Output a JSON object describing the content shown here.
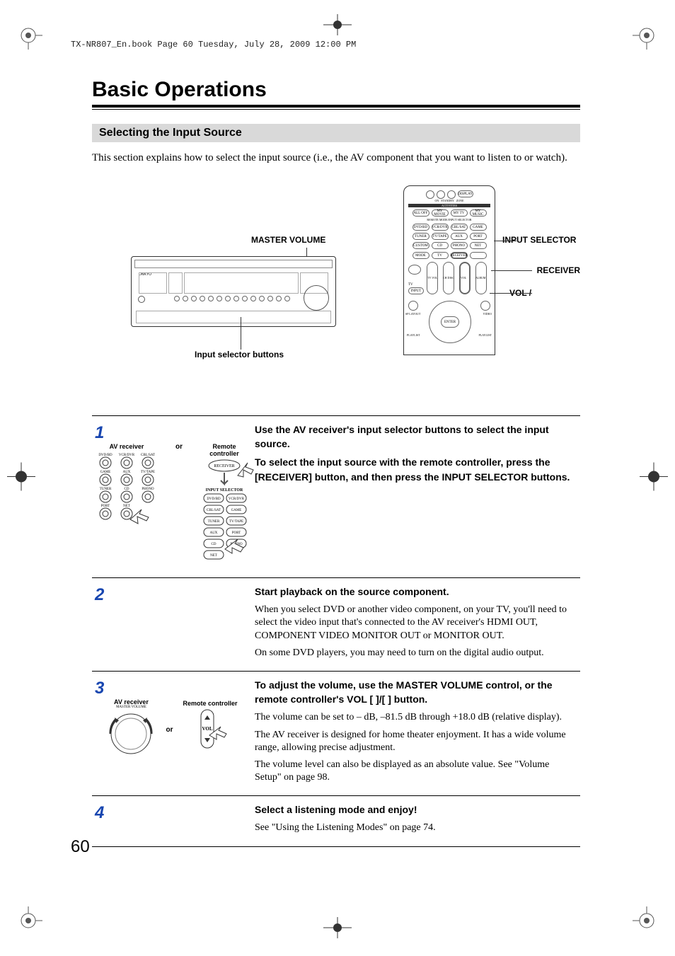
{
  "header_running": "TX-NR807_En.book  Page 60  Tuesday, July 28, 2009  12:00 PM",
  "main_heading": "Basic Operations",
  "section_heading": "Selecting the Input Source",
  "intro_text": "This section explains how to select the input source (i.e., the AV component that you want to listen to or watch).",
  "labels": {
    "master_volume": "MASTER VOLUME",
    "input_selector_buttons": "Input selector buttons",
    "input_selector": "INPUT SELECTOR",
    "receiver": "RECEIVER",
    "vol": "VOL    / ",
    "av_receiver": "AV receiver",
    "remote_controller": "Remote controller",
    "or": "or"
  },
  "remote_buttons": {
    "top": [
      "ON",
      "STANDBY",
      "ZONE",
      "DISPLAY"
    ],
    "activities_header": "ACTIVITIES",
    "activities": [
      "ALL OFF",
      "MY MOVIE",
      "MY TV",
      "MY MUSIC"
    ],
    "mode_header": "REMOTE MODE/INPUT SELECTOR",
    "grid": [
      [
        "DVD/BD",
        "VCR/DVR",
        "CBL/SAT",
        "GAME"
      ],
      [
        "TUNER",
        "TV/TAPE",
        "AUX",
        "PORT"
      ],
      [
        "CUSTOM",
        "CD",
        "PHONO",
        "NET"
      ]
    ],
    "mode_row": [
      "MODE",
      "TV",
      "RECEIVER",
      ""
    ],
    "nav": [
      "TV",
      "TV VOL",
      "CH DISC",
      "VOL",
      "ALBUM"
    ],
    "input_btn": "INPUT",
    "bottom": [
      "SP LAYOUT",
      "ENTER",
      "VIDEO",
      "PLAYLIST"
    ]
  },
  "step1_input_selector_header": "INPUT SELECTOR",
  "step1_input_selector_buttons": [
    "DVD/BD",
    "VCR/DVR",
    "CBL/SAT",
    "GAME",
    "TUNER",
    "TV/TAPE",
    "AUX",
    "PORT",
    "CD",
    "PHONO",
    "NET"
  ],
  "step1_front_buttons": [
    "DVD/BD",
    "VCR/DVR",
    "CBL/SAT",
    "GAME",
    "AUX",
    "TV/TAPE",
    "TUNER",
    "CD",
    "PHONO",
    "PORT",
    "NET"
  ],
  "step3_vol_label": "VOL",
  "step3_mv_label": "MASTER VOLUME",
  "steps": [
    {
      "num": "1",
      "av": "AV receiver",
      "rc": "Remote controller",
      "text_bold1": "Use the AV receiver's input selector buttons to select the input source.",
      "text_bold2": "To select the input source with the remote controller, press the [RECEIVER] button, and then press the INPUT SELECTOR buttons."
    },
    {
      "num": "2",
      "bold": "Start playback on the source component.",
      "body1": "When you select DVD or another video component, on your TV, you'll need to select the video input that's connected to the AV receiver's HDMI OUT, COMPONENT VIDEO MONITOR OUT or MONITOR OUT.",
      "body2": "On some DVD players, you may need to turn on the digital audio output."
    },
    {
      "num": "3",
      "av": "AV receiver",
      "rc": "Remote controller",
      "bold": "To adjust the volume, use the MASTER VOLUME control, or the remote controller's VOL [    ]/[    ] button.",
      "body1": "The volume can be set to –    dB, –81.5 dB through +18.0 dB (relative display).",
      "body2": "The AV receiver is designed for home theater enjoyment. It has a wide volume range, allowing precise adjustment.",
      "body3": "The volume level can also be displayed as an absolute value. See \"Volume Setup\" on page 98."
    },
    {
      "num": "4",
      "bold": "Select a listening mode and enjoy!",
      "body1": "See \"Using the Listening Modes\" on page 74."
    }
  ],
  "page_number": "60"
}
